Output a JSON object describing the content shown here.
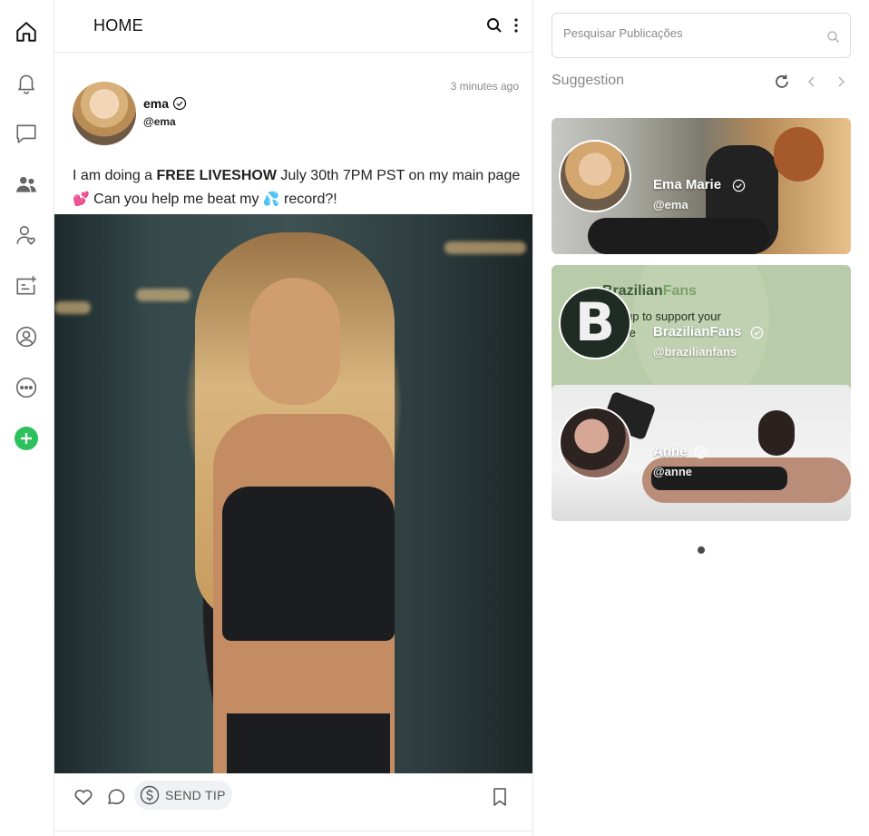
{
  "nav": {
    "items": [
      {
        "icon": "home-icon"
      },
      {
        "icon": "bell-icon"
      },
      {
        "icon": "chat-icon"
      },
      {
        "icon": "users-icon"
      },
      {
        "icon": "user-heart-icon"
      },
      {
        "icon": "add-post-icon"
      },
      {
        "icon": "profile-icon"
      },
      {
        "icon": "more-icon"
      },
      {
        "icon": "plus-icon",
        "color": "#2ec05c"
      }
    ]
  },
  "header": {
    "title": "HOME"
  },
  "post": {
    "author_name": "ema",
    "author_handle": "@ema",
    "time": "3 minutes ago",
    "text_before": "I am doing a ",
    "text_bold": "FREE LIVESHOW",
    "text_after": " July 30th 7PM PST on my main page ",
    "emoji_hearts": "💕",
    "text_line2_a": " Can you help me beat my ",
    "emoji_droplets": "💦",
    "text_line2_b": " record?!",
    "actions": {
      "tip_label": "SEND TIP"
    }
  },
  "sidebar": {
    "search_placeholder": "Pesquisar Publicações",
    "suggestion_title": "Suggestion",
    "cards": [
      {
        "name": "Ema Marie",
        "handle": "@ema"
      },
      {
        "name": "BrazilianFans",
        "handle": "@brazilianfans",
        "banner_brand_a": "Brazilian",
        "banner_brand_b": "Fans",
        "banner_text_1": "up to support your",
        "banner_text_2": "te",
        "avatar_letter": "B"
      },
      {
        "name": "Anne",
        "handle": "@anne"
      }
    ],
    "accent_color": "#2ec05c"
  }
}
